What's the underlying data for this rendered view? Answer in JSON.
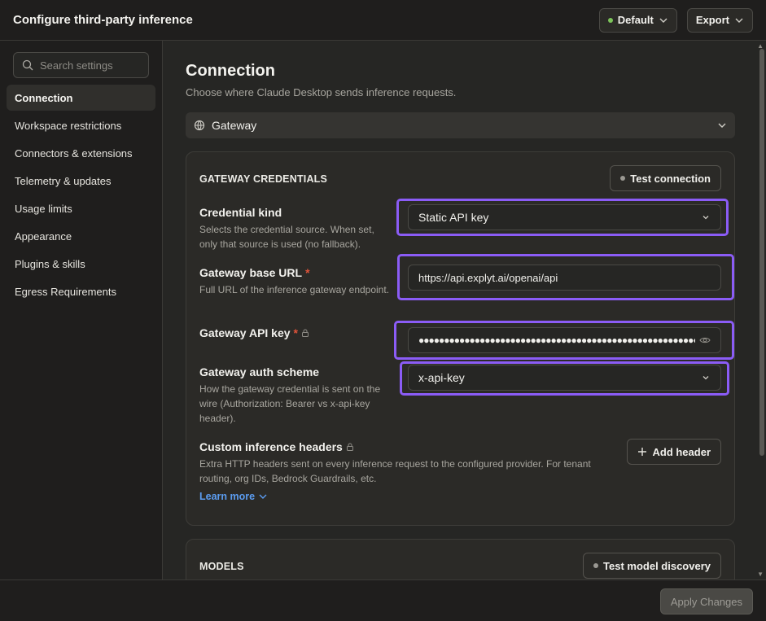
{
  "window": {
    "title": "Configure third-party inference"
  },
  "header": {
    "profile_label": "Default",
    "export_label": "Export"
  },
  "sidebar": {
    "search_placeholder": "Search settings",
    "items": [
      {
        "label": "Connection",
        "active": true
      },
      {
        "label": "Workspace restrictions"
      },
      {
        "label": "Connectors & extensions"
      },
      {
        "label": "Telemetry & updates"
      },
      {
        "label": "Usage limits"
      },
      {
        "label": "Appearance"
      },
      {
        "label": "Plugins & skills"
      },
      {
        "label": "Egress Requirements"
      }
    ]
  },
  "main": {
    "title": "Connection",
    "subtitle": "Choose where Claude Desktop sends inference requests.",
    "provider_value": "Gateway",
    "credentials": {
      "section_title": "GATEWAY CREDENTIALS",
      "test_button": "Test connection",
      "fields": {
        "credential_kind": {
          "label": "Credential kind",
          "description": "Selects the credential source. When set, only that source is used (no fallback).",
          "value": "Static API key"
        },
        "base_url": {
          "label": "Gateway base URL",
          "required_mark": "*",
          "description": "Full URL of the inference gateway endpoint.",
          "value": "https://api.explyt.ai/openai/api"
        },
        "api_key": {
          "label": "Gateway API key",
          "required_mark": "*",
          "masked_value": "●●●●●●●●●●●●●●●●●●●●●●●●●●●●●●●●●●●●●●●●●●●●●●●●●●●●●●●●●●●●●●●●●●"
        },
        "auth_scheme": {
          "label": "Gateway auth scheme",
          "description": "How the gateway credential is sent on the wire (Authorization: Bearer vs x-api-key header).",
          "value": "x-api-key"
        },
        "custom_headers": {
          "label": "Custom inference headers",
          "description": "Extra HTTP headers sent on every inference request to the configured provider. For tenant routing, org IDs, Bedrock Guardrails, etc.",
          "add_button": "Add header",
          "learn_more": "Learn more"
        }
      }
    },
    "models": {
      "section_title": "MODELS",
      "test_button": "Test model discovery"
    }
  },
  "footer": {
    "apply_label": "Apply Changes"
  },
  "colors": {
    "accent_highlight": "#8b5cf6",
    "required": "#e0533a",
    "link": "#5b9cf0",
    "status_ok": "#7cc45a"
  }
}
